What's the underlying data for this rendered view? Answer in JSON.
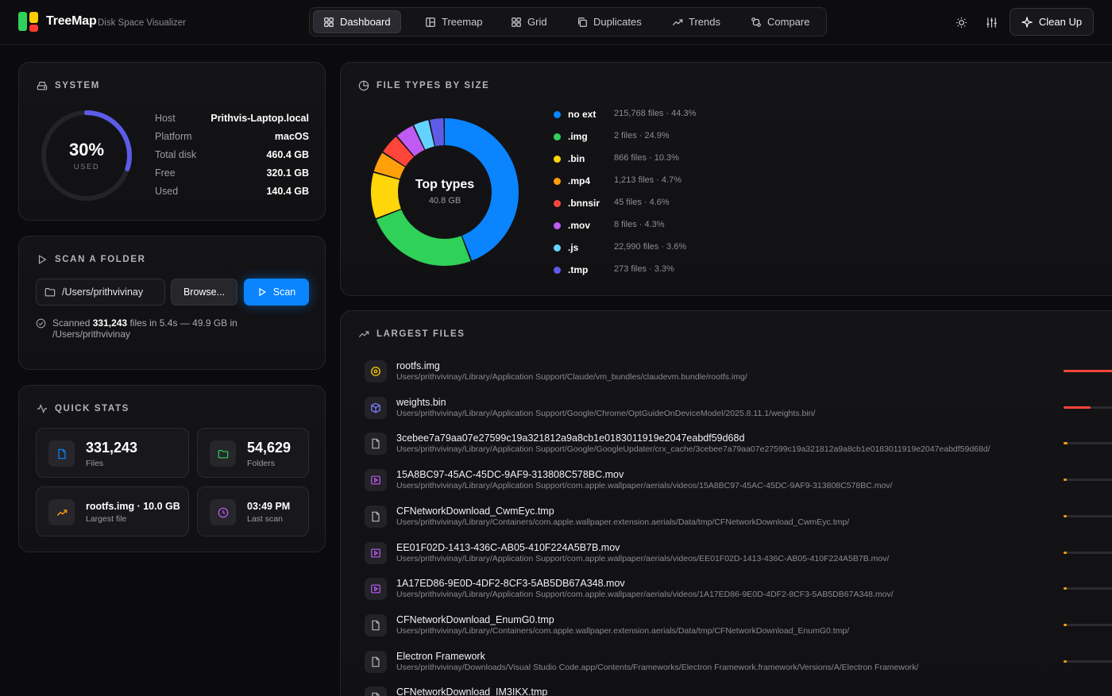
{
  "app": {
    "name": "TreeMap",
    "subtitle": "Disk Space Visualizer"
  },
  "nav": {
    "tabs": [
      {
        "label": "Dashboard",
        "icon": "dashboard-icon",
        "active": true
      },
      {
        "label": "Treemap",
        "icon": "treemap-icon",
        "active": false
      },
      {
        "label": "Grid",
        "icon": "grid-icon",
        "active": false
      },
      {
        "label": "Duplicates",
        "icon": "duplicates-icon",
        "active": false
      },
      {
        "label": "Trends",
        "icon": "trends-icon",
        "active": false
      },
      {
        "label": "Compare",
        "icon": "compare-icon",
        "active": false
      }
    ],
    "cleanup_label": "Clean Up"
  },
  "system": {
    "title": "SYSTEM",
    "used_percent": 30,
    "used_percent_label": "30%",
    "used_label": "USED",
    "rows": [
      {
        "key": "Host",
        "value": "Prithvis-Laptop.local"
      },
      {
        "key": "Platform",
        "value": "macOS"
      },
      {
        "key": "Total disk",
        "value": "460.4 GB"
      },
      {
        "key": "Free",
        "value": "320.1 GB"
      },
      {
        "key": "Used",
        "value": "140.4 GB"
      }
    ]
  },
  "scan": {
    "title": "SCAN A FOLDER",
    "path": "/Users/prithvivinay",
    "browse_label": "Browse...",
    "scan_label": "Scan",
    "result_prefix": "Scanned ",
    "result_count": "331,243",
    "result_suffix": " files in 5.4s — 49.9 GB in /Users/prithvivinay"
  },
  "quick_stats": {
    "title": "QUICK STATS",
    "files": {
      "value": "331,243",
      "label": "Files"
    },
    "folders": {
      "value": "54,629",
      "label": "Folders"
    },
    "largest": {
      "value": "rootfs.img · 10.0 GB",
      "label": "Largest file"
    },
    "last_scan": {
      "value": "03:49 PM",
      "label": "Last scan"
    }
  },
  "file_types": {
    "title": "FILE TYPES BY SIZE",
    "center_title": "Top types",
    "center_sub": "40.8 GB"
  },
  "chart_data": {
    "type": "pie",
    "title": "FILE TYPES BY SIZE",
    "categories": [
      "no ext",
      ".img",
      ".bin",
      ".mp4",
      ".bnnsir",
      ".mov",
      ".js",
      ".tmp"
    ],
    "values": [
      44.3,
      24.9,
      10.3,
      4.7,
      4.6,
      4.3,
      3.6,
      3.3
    ],
    "files": [
      "215,768 files",
      "2 files",
      "866 files",
      "1,213 files",
      "45 files",
      "8 files",
      "22,990 files",
      "273 files"
    ],
    "labels": [
      "215,768 files · 44.3%",
      "2 files · 24.9%",
      "866 files · 10.3%",
      "1,213 files · 4.7%",
      "45 files · 4.6%",
      "8 files · 4.3%",
      "22,990 files · 3.6%",
      "273 files · 3.3%"
    ],
    "colors": [
      "#0a84ff",
      "#30d158",
      "#ffd60a",
      "#ff9f0a",
      "#ff453a",
      "#bf5af2",
      "#64d2ff",
      "#5e5ce6"
    ],
    "center_label": "Top types",
    "center_value": "40.8 GB",
    "legend": "right"
  },
  "largest_files": {
    "title": "LARGEST FILES",
    "items": [
      {
        "name": "rootfs.img",
        "path": "Users/prithvivinay/Library/Application Support/Claude/vm_bundles/claudevm.bundle/rootfs.img/",
        "icon": "disk-image-icon",
        "icon_color": "#ffcc00",
        "share": 1.0,
        "bar_color": "#ff453a"
      },
      {
        "name": "weights.bin",
        "path": "Users/prithvivinay/Library/Application Support/Google/Chrome/OptGuideOnDeviceModel/2025.8.11.1/weights.bin/",
        "icon": "cube-icon",
        "icon_color": "#7d7dff",
        "share": 0.42,
        "bar_color": "#ff453a"
      },
      {
        "name": "3cebee7a79aa07e27599c19a321812a9a8cb1e0183011919e2047eabdf59d68d",
        "path": "Users/prithvivinay/Library/Application Support/Google/GoogleUpdater/crx_cache/3cebee7a79aa07e27599c19a321812a9a8cb1e0183011919e2047eabdf59d68d/",
        "icon": "file-icon",
        "icon_color": "#b4b4bb",
        "share": 0.06,
        "bar_color": "#ff9f0a"
      },
      {
        "name": "15A8BC97-45AC-45DC-9AF9-313808C578BC.mov",
        "path": "Users/prithvivinay/Library/Application Support/com.apple.wallpaper/aerials/videos/15A8BC97-45AC-45DC-9AF9-313808C578BC.mov/",
        "icon": "video-icon",
        "icon_color": "#bf5af2",
        "share": 0.05,
        "bar_color": "#ff9f0a"
      },
      {
        "name": "CFNetworkDownload_CwmEyc.tmp",
        "path": "Users/prithvivinay/Library/Containers/com.apple.wallpaper.extension.aerials/Data/tmp/CFNetworkDownload_CwmEyc.tmp/",
        "icon": "file-icon",
        "icon_color": "#b4b4bb",
        "share": 0.05,
        "bar_color": "#ff9f0a"
      },
      {
        "name": "EE01F02D-1413-436C-AB05-410F224A5B7B.mov",
        "path": "Users/prithvivinay/Library/Application Support/com.apple.wallpaper/aerials/videos/EE01F02D-1413-436C-AB05-410F224A5B7B.mov/",
        "icon": "video-icon",
        "icon_color": "#bf5af2",
        "share": 0.05,
        "bar_color": "#ff9f0a"
      },
      {
        "name": "1A17ED86-9E0D-4DF2-8CF3-5AB5DB67A348.mov",
        "path": "Users/prithvivinay/Library/Application Support/com.apple.wallpaper/aerials/videos/1A17ED86-9E0D-4DF2-8CF3-5AB5DB67A348.mov/",
        "icon": "video-icon",
        "icon_color": "#bf5af2",
        "share": 0.05,
        "bar_color": "#ff9f0a"
      },
      {
        "name": "CFNetworkDownload_EnumG0.tmp",
        "path": "Users/prithvivinay/Library/Containers/com.apple.wallpaper.extension.aerials/Data/tmp/CFNetworkDownload_EnumG0.tmp/",
        "icon": "file-icon",
        "icon_color": "#b4b4bb",
        "share": 0.05,
        "bar_color": "#ff9f0a"
      },
      {
        "name": "Electron Framework",
        "path": "Users/prithvivinay/Downloads/Visual Studio Code.app/Contents/Frameworks/Electron Framework.framework/Versions/A/Electron Framework/",
        "icon": "file-icon",
        "icon_color": "#b4b4bb",
        "share": 0.05,
        "bar_color": "#ff9f0a"
      },
      {
        "name": "CFNetworkDownload_IM3IKX.tmp",
        "path": "",
        "icon": "file-icon",
        "icon_color": "#b4b4bb",
        "share": 0.05,
        "bar_color": "#ff9f0a"
      }
    ]
  }
}
